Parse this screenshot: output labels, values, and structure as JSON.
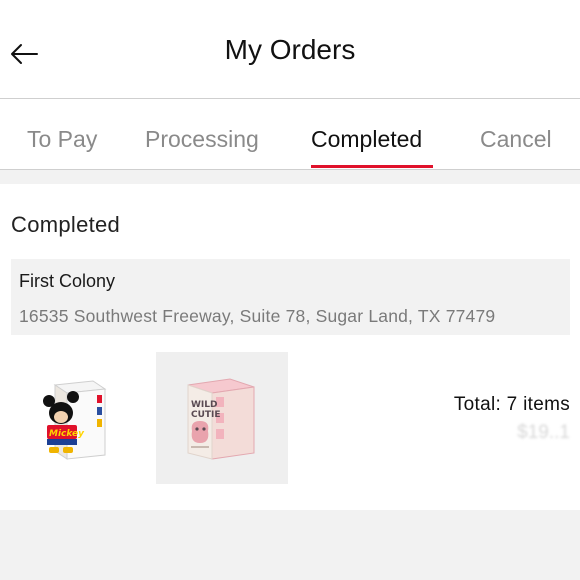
{
  "header": {
    "back_icon": "arrow-left-icon",
    "title": "My Orders"
  },
  "tabs": [
    {
      "label": "To Pay"
    },
    {
      "label": "Processing"
    },
    {
      "label": "Completed",
      "active": true
    },
    {
      "label": "Cancel"
    }
  ],
  "colors": {
    "accent": "#e0112b",
    "background": "#f2f2f2"
  },
  "order": {
    "status": "Completed",
    "address": {
      "name": "First Colony",
      "line": "16535 Southwest Freeway, Suite 78, Sugar Land, TX 77479"
    },
    "products": [
      {
        "box_text": [
          "Mickey"
        ]
      },
      {
        "box_text": [
          "WILD",
          "CUTIE"
        ]
      }
    ],
    "total_label": "Total: 7 items",
    "price": "$19..1"
  }
}
